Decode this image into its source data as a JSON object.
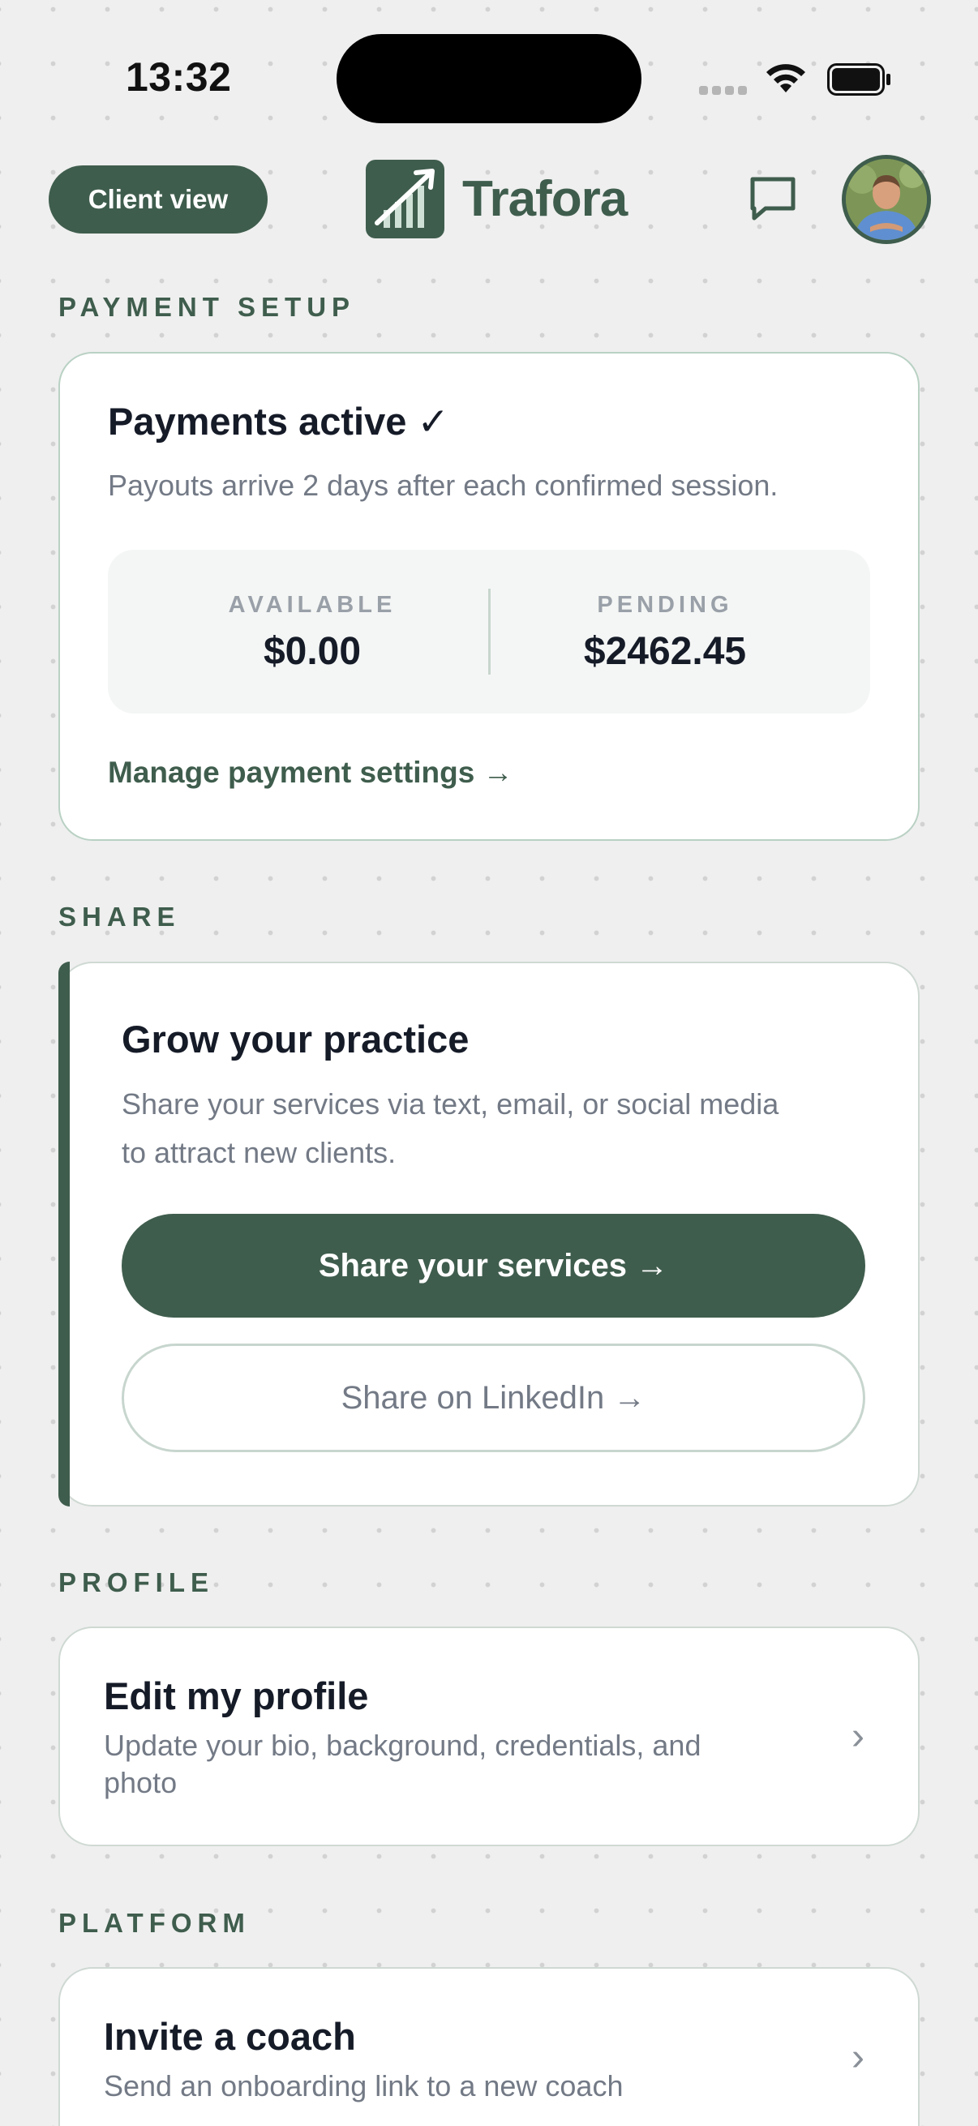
{
  "status_bar": {
    "time": "13:32"
  },
  "header": {
    "client_view_label": "Client view",
    "brand_name": "Trafora",
    "icons": [
      "chat-bubble-icon",
      "avatar"
    ]
  },
  "payment_setup": {
    "section_label": "PAYMENT SETUP",
    "title": "Payments active ✓",
    "subtitle": "Payouts arrive 2 days after each confirmed session.",
    "available_label": "AVAILABLE",
    "available_value": "$0.00",
    "pending_label": "PENDING",
    "pending_value": "$2462.45",
    "manage_link": "Manage payment settings →"
  },
  "share": {
    "section_label": "SHARE",
    "title": "Grow your practice",
    "subtitle_line1": "Share your services via text, email, or social media",
    "subtitle_line2": "to attract new clients.",
    "primary_button": "Share your services →",
    "secondary_button": "Share on LinkedIn →"
  },
  "profile": {
    "section_label": "PROFILE",
    "title": "Edit my profile",
    "subtitle_line1": "Update your bio, background, credentials, and",
    "subtitle_line2": "photo",
    "chevron": "›"
  },
  "platform": {
    "section_label": "PLATFORM",
    "title": "Invite a coach",
    "subtitle": "Send an onboarding link to a new coach",
    "chevron": "›"
  },
  "colors": {
    "brand_green": "#3f5d4d",
    "background": "#efefef",
    "muted_text": "#737a86"
  }
}
